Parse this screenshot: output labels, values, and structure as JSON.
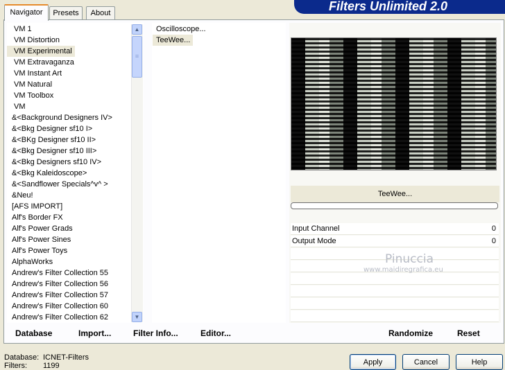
{
  "banner": {
    "title": "Filters Unlimited 2.0"
  },
  "tabs": [
    {
      "label": "Navigator",
      "active": true
    },
    {
      "label": "Presets",
      "active": false
    },
    {
      "label": "About",
      "active": false
    }
  ],
  "categories": [
    {
      "label": "VM 1"
    },
    {
      "label": "VM Distortion"
    },
    {
      "label": "VM Experimental",
      "selected": true
    },
    {
      "label": "VM Extravaganza"
    },
    {
      "label": "VM Instant Art"
    },
    {
      "label": "VM Natural"
    },
    {
      "label": "VM Toolbox"
    },
    {
      "label": "VM"
    },
    {
      "label": "&<Background Designers IV>"
    },
    {
      "label": "&<Bkg Designer sf10 I>"
    },
    {
      "label": "&<BKg Designer sf10 II>"
    },
    {
      "label": "&<Bkg Designer sf10 III>"
    },
    {
      "label": "&<Bkg Designers sf10 IV>"
    },
    {
      "label": "&<Bkg Kaleidoscope>"
    },
    {
      "label": "&<Sandflower Specials^v^ >"
    },
    {
      "label": "&Neu!"
    },
    {
      "label": "[AFS IMPORT]"
    },
    {
      "label": "Alf's Border FX"
    },
    {
      "label": "Alf's Power Grads"
    },
    {
      "label": "Alf's Power Sines"
    },
    {
      "label": "Alf's Power Toys"
    },
    {
      "label": "AlphaWorks"
    },
    {
      "label": "Andrew's Filter Collection 55"
    },
    {
      "label": "Andrew's Filter Collection 56"
    },
    {
      "label": "Andrew's Filter Collection 57"
    },
    {
      "label": "Andrew's Filter Collection 60"
    },
    {
      "label": "Andrew's Filter Collection 62"
    }
  ],
  "filters": [
    {
      "label": "Oscilloscope..."
    },
    {
      "label": "TeeWee...",
      "selected": true
    }
  ],
  "preview": {
    "filter_name": "TeeWee..."
  },
  "params": [
    {
      "label": "Input Channel",
      "value": "0"
    },
    {
      "label": "Output Mode",
      "value": "0"
    }
  ],
  "watermark": {
    "name": "Pinuccia",
    "url": "www.maidiregrafica.eu"
  },
  "toolbar": {
    "database": "Database",
    "import": "Import...",
    "filter_info": "Filter Info...",
    "editor": "Editor...",
    "randomize": "Randomize",
    "reset": "Reset"
  },
  "status": {
    "database_label": "Database:",
    "database_value": "ICNET-Filters",
    "filters_label": "Filters:",
    "filters_value": "1199"
  },
  "buttons": {
    "apply": "Apply",
    "cancel": "Cancel",
    "help": "Help"
  }
}
